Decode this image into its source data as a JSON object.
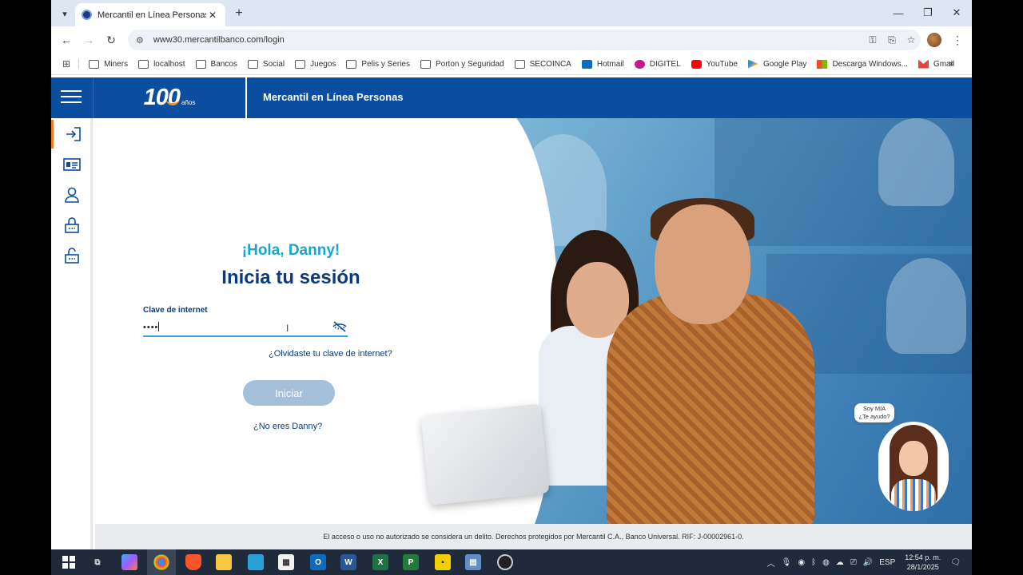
{
  "browser": {
    "tab_title": "Mercantil en Línea Personas",
    "url": "www30.mercantilbanco.com/login",
    "new_tab": "+",
    "close_tab": "✕",
    "win_minimize": "—",
    "win_restore": "❐",
    "win_close": "✕",
    "bookmarks": [
      {
        "label": "Miners",
        "icon": "folder"
      },
      {
        "label": "localhost",
        "icon": "folder"
      },
      {
        "label": "Bancos",
        "icon": "folder"
      },
      {
        "label": "Social",
        "icon": "folder"
      },
      {
        "label": "Juegos",
        "icon": "folder"
      },
      {
        "label": "Pelis y Series",
        "icon": "folder"
      },
      {
        "label": "Porton y Seguridad",
        "icon": "folder"
      },
      {
        "label": "SECOINCA",
        "icon": "folder"
      },
      {
        "label": "Hotmail",
        "icon": "outlook"
      },
      {
        "label": "DIGITEL",
        "icon": "digitel"
      },
      {
        "label": "YouTube",
        "icon": "youtube"
      },
      {
        "label": "Google Play",
        "icon": "play"
      },
      {
        "label": "Descarga Windows...",
        "icon": "windows"
      },
      {
        "label": "Gmail",
        "icon": "gmail"
      }
    ],
    "bookmarks_more": "»"
  },
  "site": {
    "logo_number": "100",
    "logo_years": "años",
    "title": "Mercantil en Línea Personas"
  },
  "login": {
    "greeting": "¡Hola, Danny!",
    "title": "Inicia tu sesión",
    "password_label": "Clave de internet",
    "password_value": "••••",
    "forgot_link": "¿Olvidaste tu clave de internet?",
    "submit_label": "Iniciar",
    "not_you_link": "¿No eres Danny?"
  },
  "assistant": {
    "bubble_line1": "Soy MIA",
    "bubble_line2": "¿Te ayudo?"
  },
  "footer": {
    "text": "El acceso o uso no autorizado se considera un delito. Derechos protegidos por Mercantil C.A., Banco Universal. RIF: J-00002961-0."
  },
  "taskbar": {
    "language": "ESP",
    "time": "12:54 p. m.",
    "date": "28/1/2025"
  },
  "colors": {
    "header_blue": "#0b4d9e",
    "greeting_cyan": "#16a7c9",
    "title_navy": "#0d3b7a",
    "accent_orange": "#f47b20",
    "button_disabled": "#a3bfda"
  }
}
